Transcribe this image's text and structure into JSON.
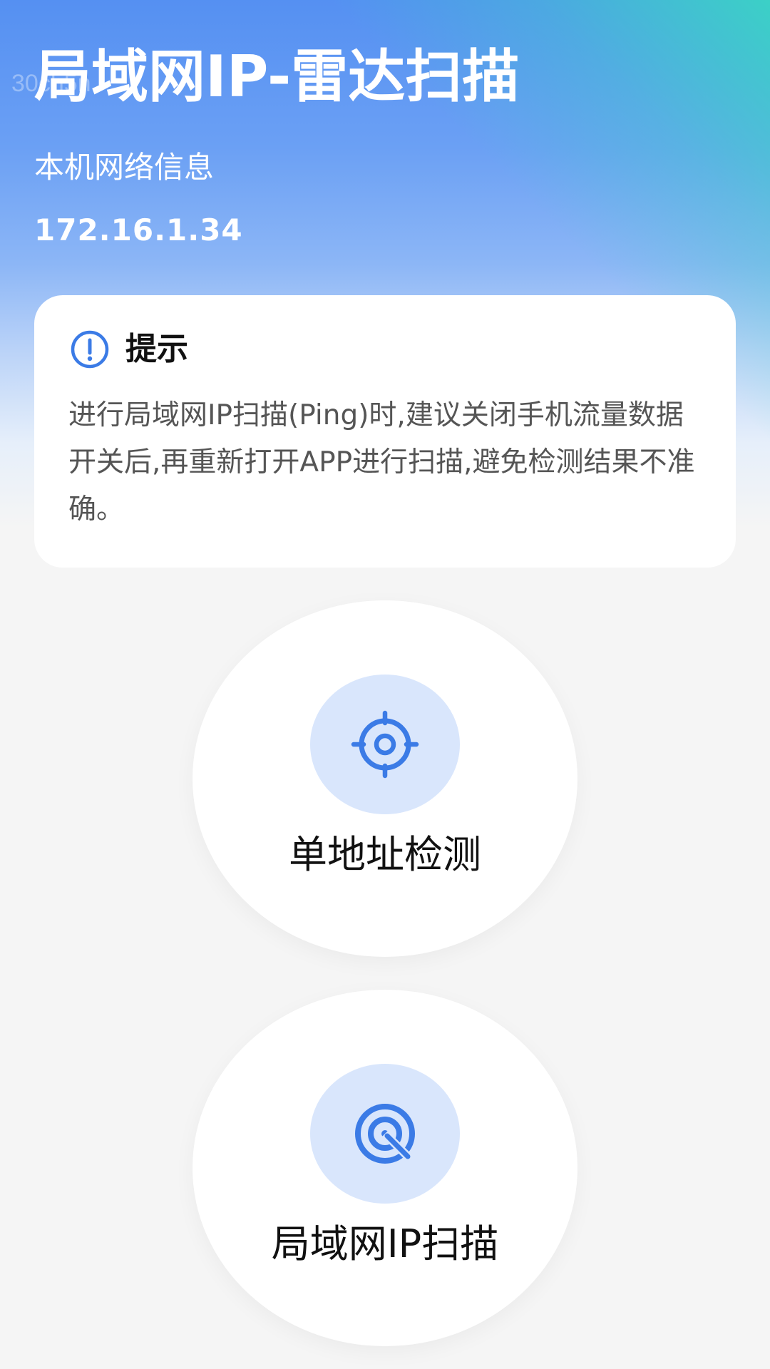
{
  "header": {
    "watermark": "30ch5n",
    "title": "局域网IP-雷达扫描",
    "network_label": "本机网络信息",
    "ip_address": "172.16.1.34"
  },
  "tip": {
    "icon": "alert-circle-icon",
    "title": "提示",
    "body": "进行局域网IP扫描(Ping)时,建议关闭手机流量数据开关后,再重新打开APP进行扫描,避免检测结果不准确。"
  },
  "actions": [
    {
      "icon": "crosshair-target-icon",
      "label": "单地址检测"
    },
    {
      "icon": "radar-scan-icon",
      "label": "局域网IP扫描"
    }
  ],
  "colors": {
    "accent": "#3b7be6",
    "icon_bg": "#d9e6fc",
    "header_gradient_start": "#5590f2",
    "header_gradient_corner": "#3ad4c4",
    "page_bg": "#f5f5f5"
  }
}
